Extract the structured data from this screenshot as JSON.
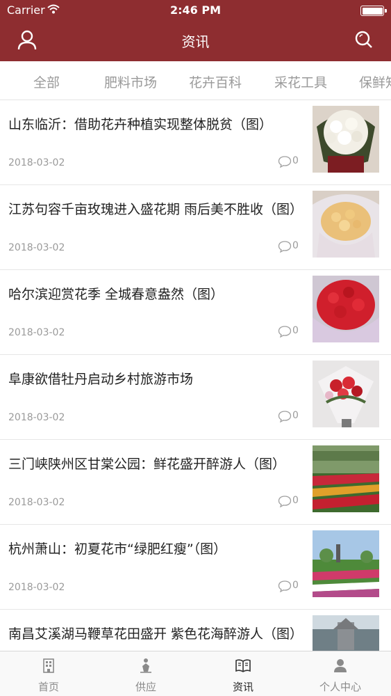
{
  "status_bar": {
    "carrier": "Carrier",
    "time": "2:46 PM"
  },
  "nav": {
    "title": "资讯",
    "left_icon": "user-icon",
    "right_icon": "search-icon",
    "bar_color": "#8e2d30"
  },
  "tabs": [
    "全部",
    "肥料市场",
    "花卉百科",
    "采花工具",
    "保鲜知"
  ],
  "articles": [
    {
      "title": "山东临沂：借助花卉种植实现整体脱贫（图）",
      "date": "2018-03-02",
      "comments": "0"
    },
    {
      "title": "江苏句容千亩玫瑰进入盛花期 雨后美不胜收（图）",
      "date": "2018-03-02",
      "comments": "0"
    },
    {
      "title": "哈尔滨迎赏花季 全城春意盎然（图）",
      "date": "2018-03-02",
      "comments": "0"
    },
    {
      "title": "阜康欲借牡丹启动乡村旅游市场",
      "date": "2018-03-02",
      "comments": "0"
    },
    {
      "title": "三门峡陕州区甘棠公园：鲜花盛开醉游人（图）",
      "date": "2018-03-02",
      "comments": "0"
    },
    {
      "title": "杭州萧山：初夏花市“绿肥红瘦”（图）",
      "date": "2018-03-02",
      "comments": "0"
    },
    {
      "title": "南昌艾溪湖马鞭草花田盛开 紫色花海醉游人（图）",
      "date": "",
      "comments": ""
    }
  ],
  "tabbar": [
    {
      "label": "首页",
      "icon": "building-icon",
      "active": false
    },
    {
      "label": "供应",
      "icon": "supply-icon",
      "active": false
    },
    {
      "label": "资讯",
      "icon": "news-icon",
      "active": true
    },
    {
      "label": "个人中心",
      "icon": "person-icon",
      "active": false
    }
  ],
  "colors": {
    "accent": "#8e2d30",
    "muted_text": "#9a9a9a",
    "divider": "#e6e6e6"
  }
}
